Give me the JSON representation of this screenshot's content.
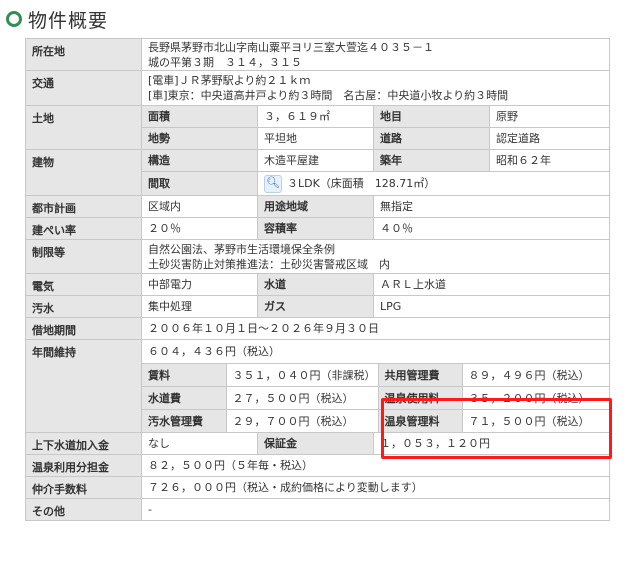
{
  "heading": "物件概要",
  "rows": {
    "location": {
      "label": "所在地",
      "line1": "長野県茅野市北山字南山粟平ヨリ三室大萱迄４０３５－１",
      "line2": "城の平第３期　３１４，３１５"
    },
    "transport": {
      "label": "交通",
      "line1": "[電車]ＪＲ茅野駅より約２１ｋｍ",
      "line2": "[車]東京：中央道高井戸より約３時間　名古屋：中央道小牧より約３時間"
    },
    "land": {
      "label": "土地",
      "area_label": "面積",
      "area_value": "３，６１９㎡",
      "category_label": "地目",
      "category_value": "原野",
      "terrain_label": "地勢",
      "terrain_value": "平坦地",
      "road_label": "道路",
      "road_value": "認定道路"
    },
    "building": {
      "label": "建物",
      "structure_label": "構造",
      "structure_value": "木造平屋建",
      "age_label": "築年",
      "age_value": "昭和６２年",
      "layout_label": "間取",
      "layout_value": "３LDK（床面積　128.71㎡）"
    },
    "planning": {
      "label": "都市計画",
      "value": "区域内",
      "zone_label": "用途地域",
      "zone_value": "無指定"
    },
    "coverage": {
      "label": "建ぺい率",
      "value": "２０％",
      "far_label": "容積率",
      "far_value": "４０％"
    },
    "restrictions": {
      "label": "制限等",
      "line1": "自然公園法、茅野市生活環境保全条例",
      "line2": "土砂災害防止対策推進法：土砂災害警戒区域　内"
    },
    "electricity": {
      "label": "電気",
      "value": "中部電力",
      "water_label": "水道",
      "water_value": "ＡＲＬ上水道"
    },
    "sewage": {
      "label": "汚水",
      "value": "集中処理",
      "gas_label": "ガス",
      "gas_value": "LPG"
    },
    "lease": {
      "label": "借地期間",
      "value": "２００６年１０月１日～２０２６年９月３０日"
    },
    "maintenance": {
      "label": "年間維持",
      "total": "６０４，４３６円（税込）",
      "rent_label": "賃料",
      "rent_value": "３５１，０４０円（非課税）",
      "common_label": "共用管理費",
      "common_value": "８９，４９６円（税込）",
      "water_fee_label": "水道費",
      "water_fee_value": "２７，５００円（税込）",
      "onsen_use_label": "温泉使用料",
      "onsen_use_value": "３５，２００円（税込）",
      "sewage_fee_label": "汚水管理費",
      "sewage_fee_value": "２９，７００円（税込）",
      "onsen_mgmt_label": "温泉管理料",
      "onsen_mgmt_value": "７１，５００円（税込）"
    },
    "water_connection": {
      "label": "上下水道加入金",
      "value": "なし",
      "deposit_label": "保証金",
      "deposit_value": "１，０５３，１２０円"
    },
    "onsen_share": {
      "label": "温泉利用分担金",
      "value": "８２，５００円（５年毎・税込）"
    },
    "brokerage": {
      "label": "仲介手数料",
      "value": "７２６，０００円（税込・成約価格により変動します）"
    },
    "other": {
      "label": "その他",
      "value": "-"
    }
  },
  "colors": {
    "accent": "#2f8f55",
    "highlight": "#ff1a1a",
    "header_bg": "#e6e6e6"
  }
}
